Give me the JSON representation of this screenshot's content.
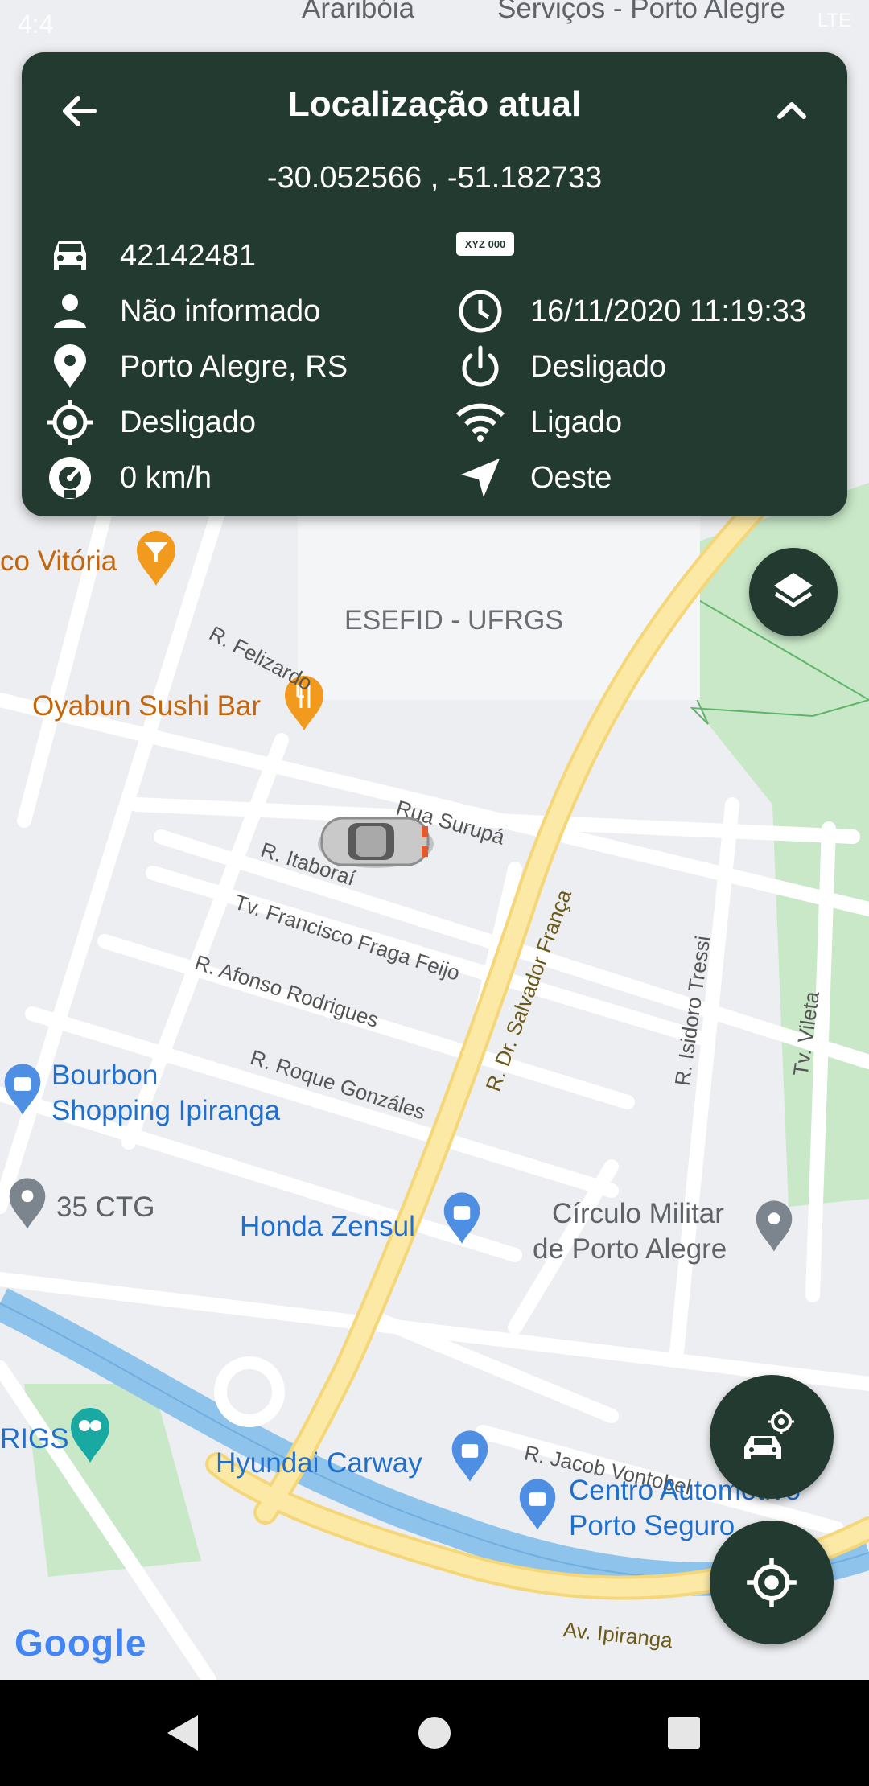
{
  "status_bar": {
    "time": "4:4",
    "network": "LTE"
  },
  "card": {
    "title": "Localização atual",
    "coordinates": "-30.052566 , -51.182733",
    "vehicle_id": "42142481",
    "plate_badge": "XYZ 000",
    "driver": "Não informado",
    "datetime": "16/11/2020 11:19:33",
    "location": "Porto Alegre, RS",
    "ignition": "Desligado",
    "gps": "Desligado",
    "wifi": "Ligado",
    "speed": "0 km/h",
    "direction": "Oeste"
  },
  "map": {
    "top_labels": [
      "Araribóia",
      "Serviços - Porto Alegre"
    ],
    "area_name": "ESEFID - UFRGS",
    "pois": {
      "vitoria": "co Vitória",
      "oyabun": "Oyabun Sushi Bar",
      "bourbon_line1": "Bourbon",
      "bourbon_line2": "Shopping Ipiranga",
      "ctg": "35 CTG",
      "honda": "Honda Zensul",
      "circulo_line1": "Círculo Militar",
      "circulo_line2": "de Porto Alegre",
      "rigs": "RIGS",
      "hyundai": "Hyundai Carway",
      "centro_line1": "Centro Automotivo",
      "centro_line2": "Porto Seguro"
    },
    "streets": {
      "felizardo": "R. Felizardo",
      "surupa": "Rua Surupá",
      "itaborai": "R. Itaboraí",
      "fraga": "Tv. Francisco Fraga Feijo",
      "afonso": "R. Afonso Rodrigues",
      "roque": "R. Roque Gonzáles",
      "salvador": "R. Dr. Salvador França",
      "isidoro": "R. Isidoro Tressi",
      "vileta": "Tv. Vileta",
      "jacob": "R. Jacob Vontobel",
      "ipiranga": "Av. Ipiranga"
    },
    "attribution": "Google"
  },
  "colors": {
    "card_bg": "#233a30",
    "fab_bg": "#233a30",
    "road_main": "#fbe38f",
    "river": "#8ec4ec",
    "park": "#c8e8c8"
  }
}
